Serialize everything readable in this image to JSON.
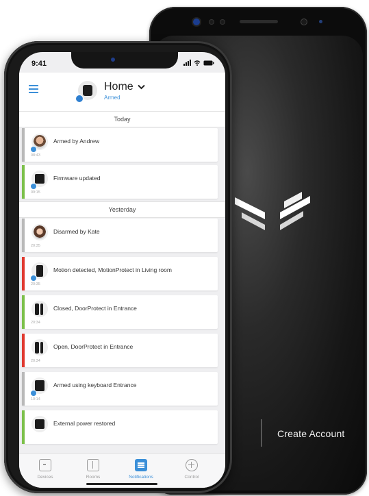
{
  "status": {
    "time": "9:41"
  },
  "header": {
    "title": "Home",
    "subtitle": "Armed"
  },
  "sections": {
    "today": "Today",
    "yesterday": "Yesterday"
  },
  "events": [
    {
      "message": "Armed by Andrew",
      "time": "08:43",
      "stripe": "#b9b9b9",
      "icon": "user-avatar-andrew"
    },
    {
      "message": "Firmware updated",
      "time": "09:15",
      "stripe": "#7cc04a",
      "icon": "hub-device-icon"
    },
    {
      "message": "Disarmed by Kate",
      "time": "20:35",
      "stripe": "#b9b9b9",
      "icon": "user-avatar-kate"
    },
    {
      "message": "Motion detected, MotionProtect in Living room",
      "time": "20:35",
      "stripe": "#e0392f",
      "icon": "motion-sensor-icon"
    },
    {
      "message": "Closed, DoorProtect in Entrance",
      "time": "20:34",
      "stripe": "#7cc04a",
      "icon": "door-sensor-icon"
    },
    {
      "message": "Open, DoorProtect in Entrance",
      "time": "20:34",
      "stripe": "#e0392f",
      "icon": "door-sensor-icon"
    },
    {
      "message": "Armed using keyboard Entrance",
      "time": "10:14",
      "stripe": "#b9b9b9",
      "icon": "keypad-icon"
    },
    {
      "message": "External power restored",
      "time": "",
      "stripe": "#7cc04a",
      "icon": "hub-device-icon"
    }
  ],
  "tabs": [
    {
      "label": "Devices",
      "icon": "devices-icon"
    },
    {
      "label": "Rooms",
      "icon": "rooms-icon"
    },
    {
      "label": "Notifications",
      "icon": "notifications-icon"
    },
    {
      "label": "Control",
      "icon": "control-icon"
    }
  ],
  "back_phone": {
    "cta": "Create Account"
  },
  "colors": {
    "accent": "#3b8fd8",
    "ok": "#7cc04a",
    "alarm": "#e0392f",
    "neutral": "#b9b9b9"
  }
}
